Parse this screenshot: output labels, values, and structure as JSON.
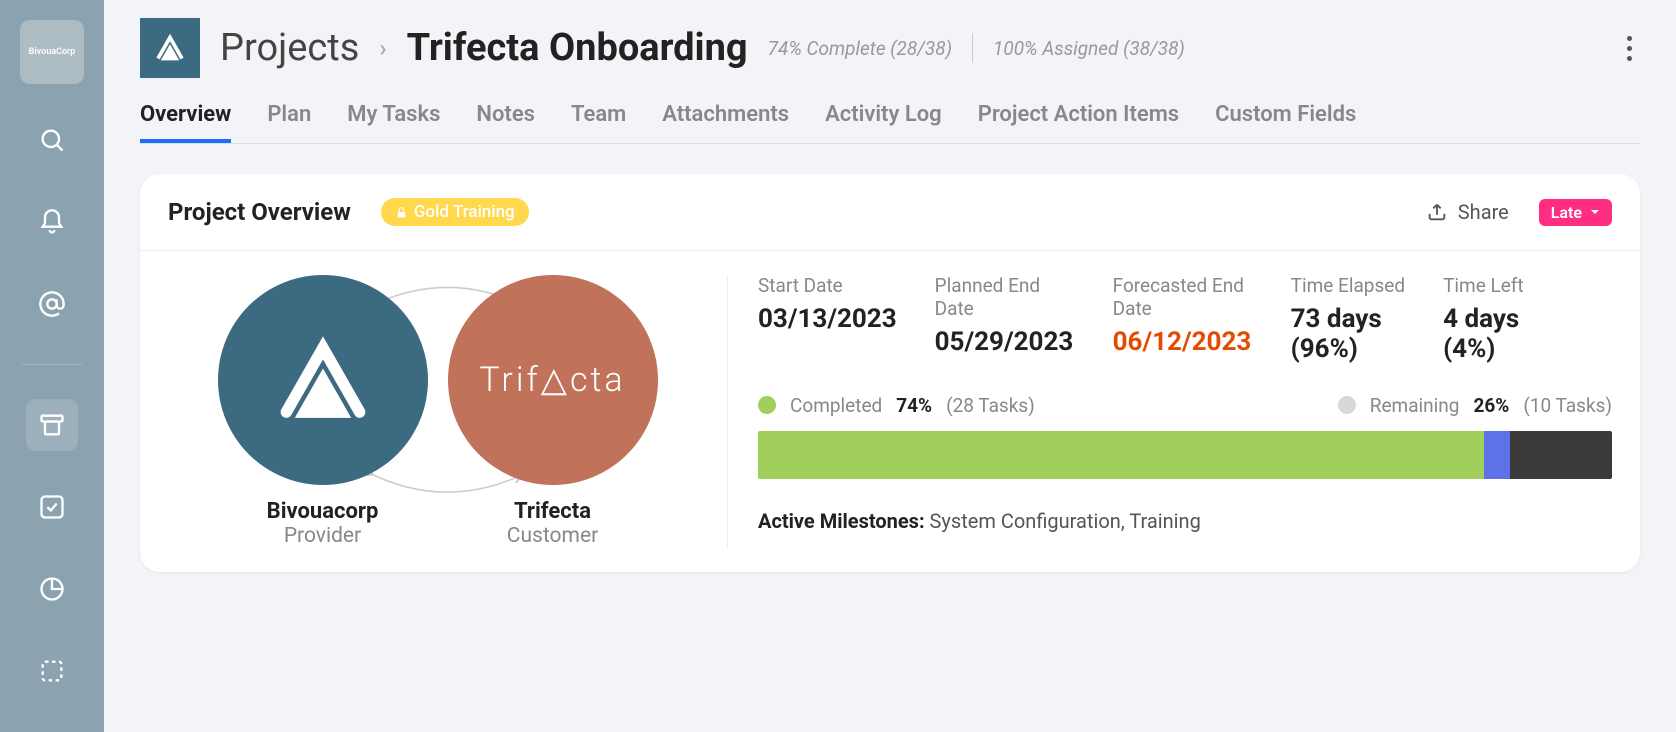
{
  "sidebar": {
    "logo_text": "BivouaCorp"
  },
  "breadcrumb": {
    "section": "Projects",
    "project": "Trifecta Onboarding"
  },
  "header_stats": {
    "complete": "74% Complete (28/38)",
    "assigned": "100% Assigned (38/38)"
  },
  "tabs": [
    "Overview",
    "Plan",
    "My Tasks",
    "Notes",
    "Team",
    "Attachments",
    "Activity Log",
    "Project Action Items",
    "Custom Fields"
  ],
  "card": {
    "title": "Project Overview",
    "gold_pill": "Gold Training",
    "share": "Share",
    "status_badge": "Late"
  },
  "partners": {
    "provider_name": "Bivouacorp",
    "provider_role": "Provider",
    "customer_name": "Trifecta",
    "customer_role": "Customer",
    "customer_wordmark_a": "Trif",
    "customer_wordmark_b": "cta"
  },
  "dates": {
    "start_label": "Start Date",
    "start_value": "03/13/2023",
    "planned_label": "Planned End Date",
    "planned_value": "05/29/2023",
    "forecast_label": "Forecasted End Date",
    "forecast_value": "06/12/2023",
    "elapsed_label": "Time Elapsed",
    "elapsed_value": "73 days (96%)",
    "left_label": "Time Left",
    "left_value": "4 days (4%)"
  },
  "progress": {
    "completed_label": "Completed",
    "completed_pct": "74%",
    "completed_count": "(28 Tasks)",
    "remaining_label": "Remaining",
    "remaining_pct": "26%",
    "remaining_count": "(10 Tasks)",
    "bar": {
      "done_width": "85%",
      "mid_width": "3%",
      "rest_width": "12%"
    }
  },
  "milestones": {
    "label": "Active Milestones:",
    "value": "System Configuration, Training"
  },
  "colors": {
    "accent_teal": "#3c6a81",
    "accent_rust": "#c0725b",
    "status_late": "#ff2e83",
    "progress_done": "#a0cf5b"
  }
}
